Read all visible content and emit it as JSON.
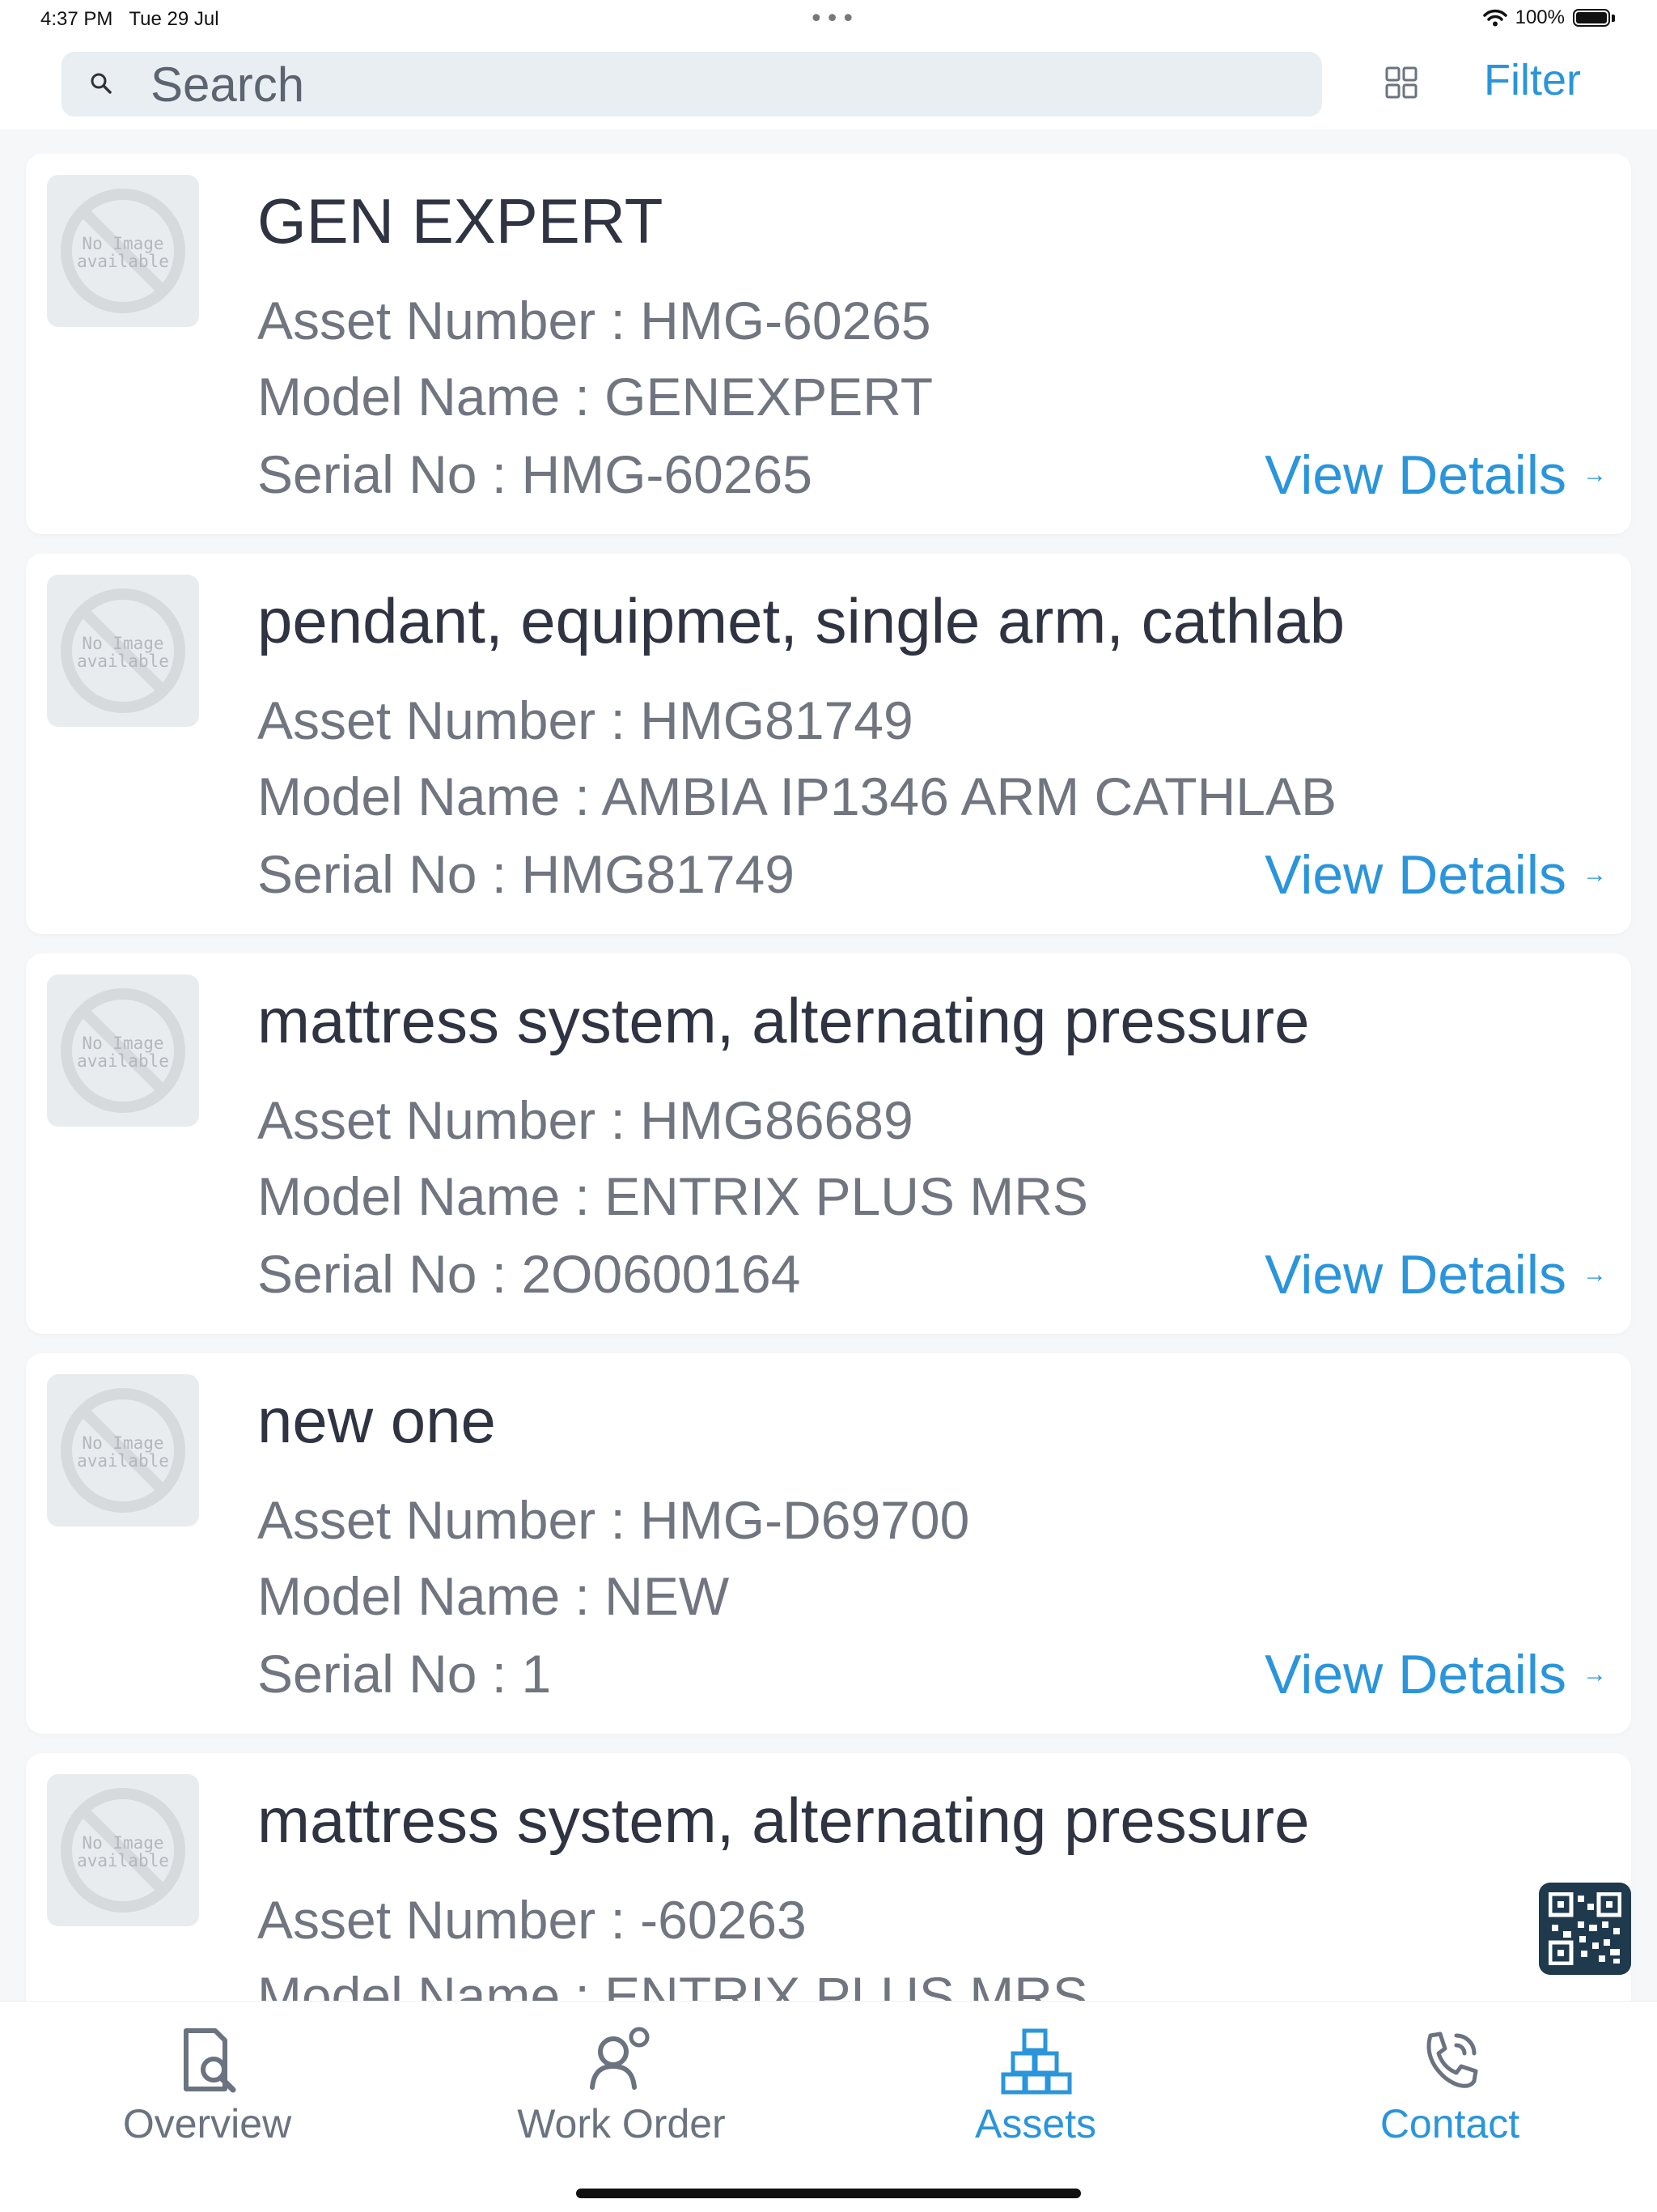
{
  "status_bar": {
    "time": "4:37 PM",
    "date": "Tue 29 Jul",
    "battery": "100%"
  },
  "search": {
    "placeholder": "Search"
  },
  "header": {
    "filter_label": "Filter"
  },
  "thumbnail_text": "No Image\navailable",
  "view_details_label": "View Details",
  "assets": [
    {
      "title": "GEN EXPERT",
      "asset_number": "Asset Number : HMG-60265",
      "model_name": "Model Name : GENEXPERT",
      "serial_no": "Serial No : HMG-60265"
    },
    {
      "title": "pendant, equipmet, single arm, cathlab",
      "asset_number": "Asset Number : HMG81749",
      "model_name": "Model Name : AMBIA  IP1346 ARM CATHLAB",
      "serial_no": "Serial No : HMG81749"
    },
    {
      "title": "mattress system, alternating pressure",
      "asset_number": "Asset Number : HMG86689",
      "model_name": "Model Name : ENTRIX PLUS MRS",
      "serial_no": "Serial No : 2O0600164"
    },
    {
      "title": "new one",
      "asset_number": "Asset Number : HMG-D69700",
      "model_name": "Model Name : NEW",
      "serial_no": "Serial No : 1"
    },
    {
      "title": "mattress system, alternating pressure",
      "asset_number": "Asset Number : -60263",
      "model_name": "Model Name : ENTRIX PLUS MRS",
      "serial_no": ""
    }
  ],
  "tabs": [
    {
      "label": "Overview",
      "icon": "overview-icon"
    },
    {
      "label": "Work Order",
      "icon": "work-order-icon"
    },
    {
      "label": "Assets",
      "icon": "assets-icon"
    },
    {
      "label": "Contact",
      "icon": "contact-icon"
    }
  ],
  "colors": {
    "accent": "#2a95db",
    "text": "#2f3342",
    "muted": "#707580",
    "background": "#f5f7f9",
    "qr_button": "#1f3a4d"
  }
}
